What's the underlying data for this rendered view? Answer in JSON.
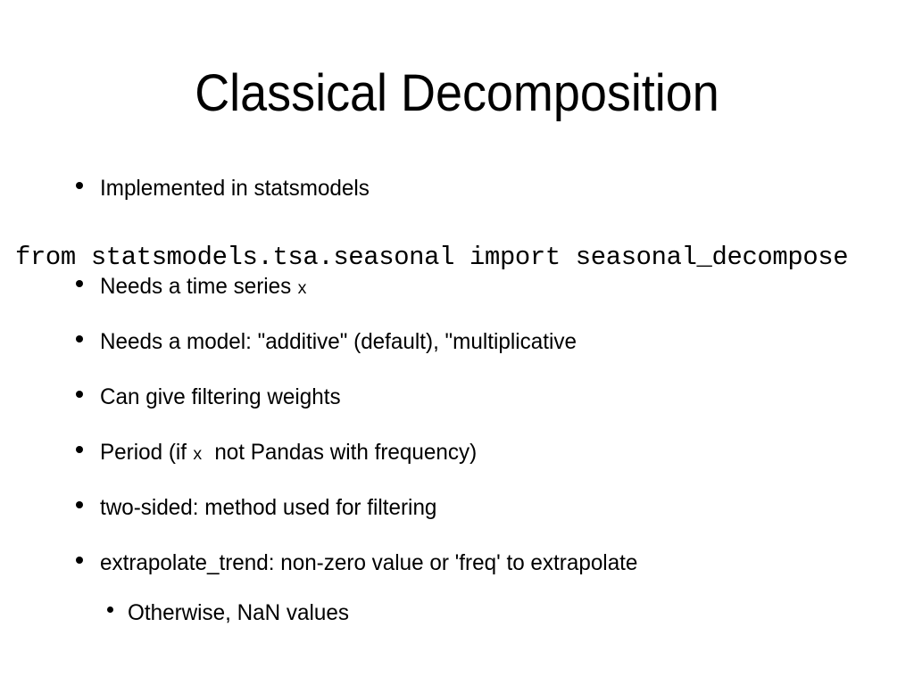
{
  "slide": {
    "title": "Classical Decomposition",
    "background_color": "#ffffff",
    "text_color": "#000000",
    "code_line": "from statsmodels.tsa.seasonal import seasonal_decompose",
    "bullets": [
      {
        "level": 0,
        "text": "Implemented in statsmodels",
        "bullet_glyph": "•"
      },
      {
        "level": 0,
        "text_before": "Needs a time series ",
        "code": "x",
        "text_after": "",
        "bullet_glyph": "•"
      },
      {
        "level": 0,
        "text": "Needs a model: \"additive\" (default), \"multiplicative",
        "bullet_glyph": "•"
      },
      {
        "level": 0,
        "text": "Can give filtering weights",
        "bullet_glyph": "•"
      },
      {
        "level": 0,
        "text_before": "Period (if ",
        "code": "x",
        "text_after": "  not Pandas with frequency)",
        "bullet_glyph": "•"
      },
      {
        "level": 0,
        "text": "two-sided: method used for filtering",
        "bullet_glyph": "•"
      },
      {
        "level": 0,
        "text": "extrapolate_trend: non-zero value or 'freq' to extrapolate",
        "bullet_glyph": "•"
      },
      {
        "level": 1,
        "text": "Otherwise, NaN values",
        "bullet_glyph": "•"
      }
    ]
  }
}
